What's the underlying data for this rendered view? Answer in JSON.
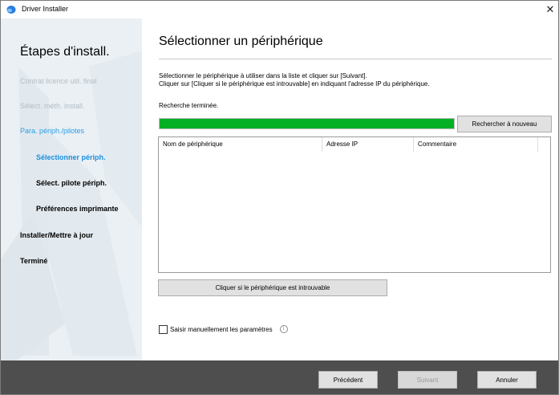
{
  "window": {
    "title": "Driver Installer",
    "close_glyph": "✕"
  },
  "sidebar": {
    "heading": "Étapes d'install.",
    "steps": [
      {
        "label": "Contrat licence util. final",
        "state": "done"
      },
      {
        "label": "Sélect. méth. install.",
        "state": "done"
      },
      {
        "label": "Para. périph./pilotes",
        "state": "active"
      },
      {
        "label": "Sélectionner périph.",
        "state": "current"
      },
      {
        "label": "Sélect. pilote périph.",
        "state": "pending"
      },
      {
        "label": "Préférences imprimante",
        "state": "pending"
      },
      {
        "label": "Installer/Mettre à jour",
        "state": "pending"
      },
      {
        "label": "Terminé",
        "state": "pending"
      }
    ]
  },
  "main": {
    "title": "Sélectionner un périphérique",
    "description_line1": "Sélectionner le périphérique à utiliser dans la liste et cliquer sur [Suivant].",
    "description_line2": "Cliquer sur [Cliquer si le périphérique est introuvable] en indiquant l'adresse IP du périphérique.",
    "status": "Recherche terminée.",
    "progress": 1.0,
    "rescan_label": "Rechercher à nouveau",
    "table": {
      "columns": [
        "Nom de périphérique",
        "Adresse IP",
        "Commentaire"
      ],
      "rows": []
    },
    "not_found_label": "Cliquer si le périphérique est introuvable",
    "manual_label": "Saisir manuellement les paramètres",
    "manual_checked": false,
    "info_glyph": "i"
  },
  "footer": {
    "prev_label": "Précédent",
    "next_label": "Suivant",
    "cancel_label": "Annuler",
    "next_enabled": false
  },
  "colors": {
    "accent": "#1a8fe0",
    "progress": "#06b025",
    "footer": "#4e4e4e",
    "sidebar": "#eaf0f4"
  }
}
